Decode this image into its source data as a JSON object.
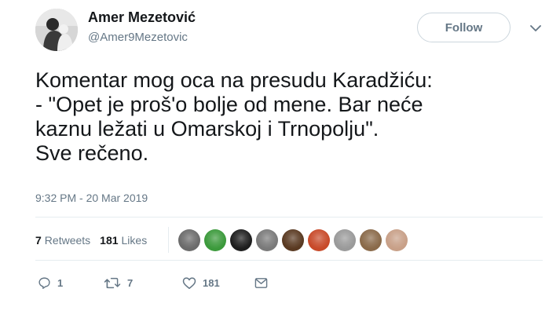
{
  "author": {
    "name": "Amer Mezetović",
    "handle": "@Amer9Mezetovic"
  },
  "follow_label": "Follow",
  "tweet": {
    "lines": [
      "Komentar mog oca na presudu Karadžiću:",
      "- \"Opet je proš'o bolje od mene. Bar neće",
      "kaznu ležati u Omarskoj i Trnopolju\".",
      "Sve rečeno."
    ],
    "timestamp": "9:32 PM - 20 Mar 2019"
  },
  "stats": {
    "retweets_count": "7",
    "retweets_label": "Retweets",
    "likes_count": "181",
    "likes_label": "Likes"
  },
  "likers": [
    {
      "color": "#6b6b6b"
    },
    {
      "color": "#3c9a3c"
    },
    {
      "color": "#1e1e1e"
    },
    {
      "color": "#7a7a7a"
    },
    {
      "color": "#5a3a22"
    },
    {
      "color": "#c84a2a"
    },
    {
      "color": "#9a9a9a"
    },
    {
      "color": "#8a6a4a"
    },
    {
      "color": "#c8a088"
    }
  ],
  "actions": {
    "reply_count": "1",
    "retweet_count": "7",
    "like_count": "181"
  },
  "colors": {
    "text": "#14171a",
    "secondary": "#657786",
    "border": "#e6ecf0"
  }
}
